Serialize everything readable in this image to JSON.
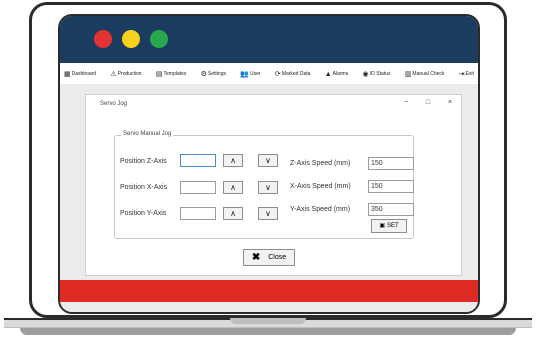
{
  "menu": {
    "items": [
      {
        "label": "Dashboard",
        "icon": "dashboard-icon",
        "glyph": "▦"
      },
      {
        "label": "Production",
        "icon": "production-icon",
        "glyph": "⚠"
      },
      {
        "label": "Templates",
        "icon": "templates-icon",
        "glyph": "▤"
      },
      {
        "label": "Settings",
        "icon": "settings-icon",
        "glyph": "⚙"
      },
      {
        "label": "User",
        "icon": "users-icon",
        "glyph": "👥"
      },
      {
        "label": "Marked Data",
        "icon": "marked-data-icon",
        "glyph": "⟳"
      },
      {
        "label": "Alarms",
        "icon": "alarm-icon",
        "glyph": "▲"
      },
      {
        "label": "IO Status",
        "icon": "io-status-icon",
        "glyph": "◉"
      },
      {
        "label": "Manual Check",
        "icon": "manual-check-icon",
        "glyph": "▥"
      },
      {
        "label": "Exit",
        "icon": "exit-icon",
        "glyph": "⇥"
      }
    ]
  },
  "dialog": {
    "title": "Servo Jog",
    "minimize": "−",
    "maximize": "□",
    "close": "×",
    "group_title": "Servo Manual Jog",
    "position_z_label": "Position Z-Axis",
    "position_x_label": "Position X-Axis",
    "position_y_label": "Position Y-Axis",
    "up_glyph": "∧",
    "down_glyph": "∨",
    "z_speed_label": "Z-Axis Speed (mm)",
    "x_speed_label": "X-Axis Speed (mm)",
    "y_speed_label": "Y-Axis Speed (mm)",
    "z_speed_value": "150",
    "x_speed_value": "150",
    "y_speed_value": "350",
    "set_label": "SET",
    "close_label": "Close",
    "close_icon": "✖",
    "set_icon": "▣"
  },
  "colors": {
    "titlebar": "#193c5f",
    "red_dot": "#e23232",
    "yellow_dot": "#f7d21c",
    "green_dot": "#27a84a",
    "footer_bar": "#e02b24"
  }
}
